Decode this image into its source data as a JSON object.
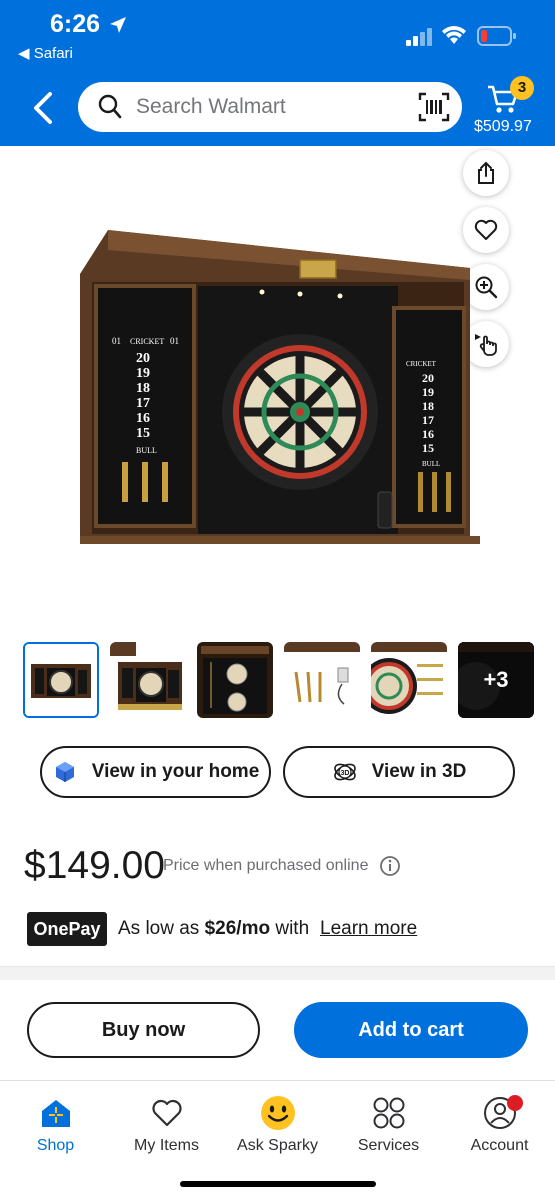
{
  "status_bar": {
    "time": "6:26",
    "back_app": "◀ Safari"
  },
  "header": {
    "search_placeholder": "Search Walmart",
    "cart_count": "3",
    "cart_total": "$509.97",
    "accent_color": "#0071dc",
    "badge_color": "#ffc220"
  },
  "thumbnails": {
    "more_label": "+3"
  },
  "actions": {
    "view_home_label": "View in your home",
    "view_3d_label": "View in 3D"
  },
  "pricing": {
    "price": "$149.00",
    "price_note": "Price when purchased online"
  },
  "onepay": {
    "logo_text": "OnePay",
    "prefix": "As low as",
    "amount": "$26/mo",
    "suffix": "with",
    "learn_more": "Learn more"
  },
  "purchase": {
    "buy_now_label": "Buy now",
    "add_to_cart_label": "Add to cart"
  },
  "tabbar": {
    "items": [
      {
        "label": "Shop",
        "icon": "home-icon"
      },
      {
        "label": "My Items",
        "icon": "heart-icon"
      },
      {
        "label": "Ask Sparky",
        "icon": "sparky-icon"
      },
      {
        "label": "Services",
        "icon": "grid-icon"
      },
      {
        "label": "Account",
        "icon": "user-icon"
      }
    ]
  },
  "dartboard_labels": {
    "title": "CRICKET",
    "numbers": [
      "20",
      "19",
      "18",
      "17",
      "16",
      "15"
    ],
    "bull": "BULL",
    "side_left": "01",
    "side_right": "01"
  }
}
